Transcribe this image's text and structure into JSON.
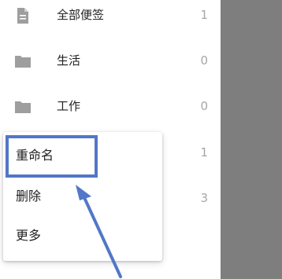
{
  "drawer": {
    "items": [
      {
        "label": "全部便签",
        "count": "1",
        "icon": "document-icon"
      },
      {
        "label": "生活",
        "count": "0",
        "icon": "folder-icon"
      },
      {
        "label": "工作",
        "count": "0",
        "icon": "folder-icon"
      },
      {
        "label": "",
        "count": "1",
        "icon": ""
      },
      {
        "label": "",
        "count": "3",
        "icon": ""
      }
    ]
  },
  "context_menu": {
    "items": [
      "重命名",
      "删除",
      "更多"
    ]
  },
  "colors": {
    "overlay": "#7e7e7e",
    "highlight": "#5277c8",
    "icon": "#9e9e9e",
    "count_text": "#a6a6a6"
  }
}
